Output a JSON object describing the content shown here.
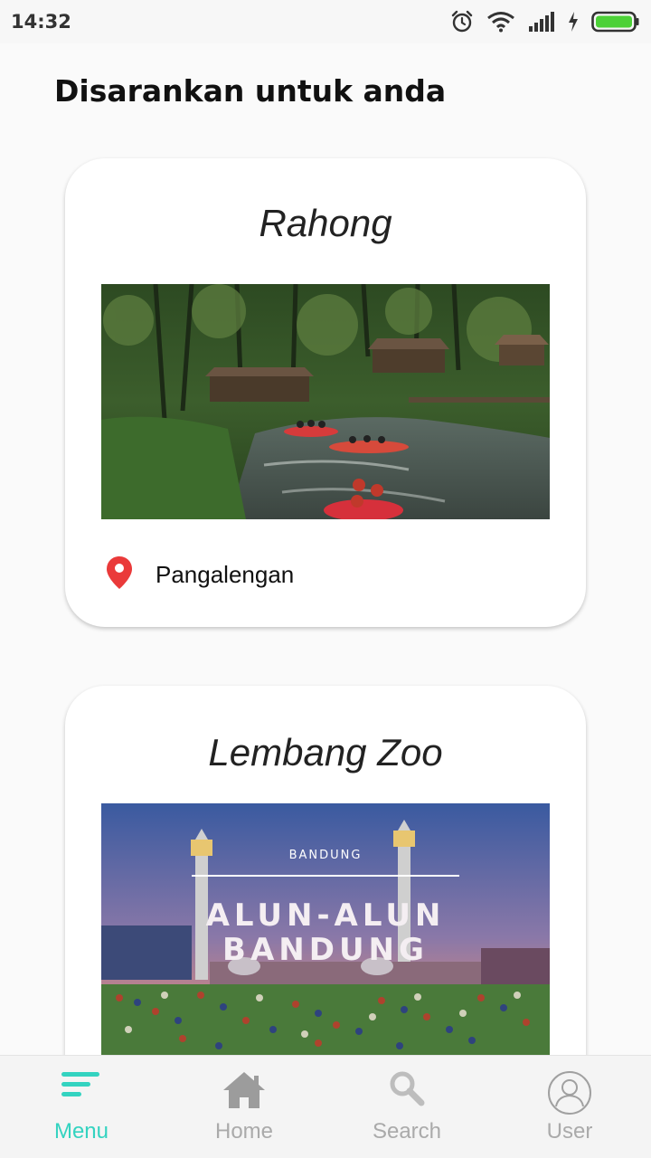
{
  "status_bar": {
    "time": "14:32",
    "icons": [
      "alarm-icon",
      "wifi-icon",
      "signal-icon",
      "charging-icon",
      "battery-icon"
    ],
    "battery_color": "#4cd137"
  },
  "page": {
    "title": "Disarankan untuk anda"
  },
  "cards": [
    {
      "title": "Rahong",
      "image": "river-rafting-photo",
      "location": "Pangalengan",
      "location_icon": "map-pin-icon"
    },
    {
      "title": "Lembang Zoo",
      "image": "alun-alun-bandung-photo",
      "image_text": {
        "kicker": "BANDUNG",
        "line1": "ALUN-ALUN",
        "line2": "BANDUNG"
      }
    }
  ],
  "bottom_nav": {
    "items": [
      {
        "label": "Menu",
        "icon": "menu-icon",
        "active": true
      },
      {
        "label": "Home",
        "icon": "home-icon",
        "active": false
      },
      {
        "label": "Search",
        "icon": "search-icon",
        "active": false
      },
      {
        "label": "User",
        "icon": "user-icon",
        "active": false
      }
    ],
    "active_color": "#33d3c0",
    "inactive_color": "#aaaaaa"
  }
}
